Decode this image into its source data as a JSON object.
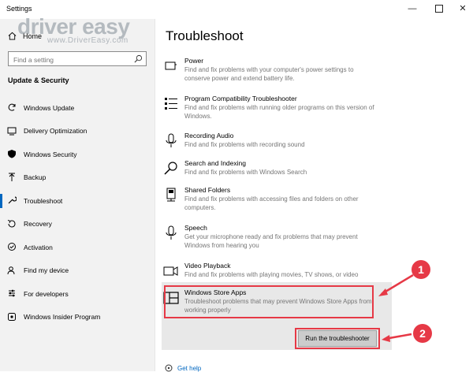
{
  "window": {
    "title": "Settings",
    "controls": {
      "minimize": "—",
      "close": "✕"
    }
  },
  "watermark": {
    "brand": "driver easy",
    "url": "www.DriverEasy.com"
  },
  "sidebar": {
    "home_label": "Home",
    "search_placeholder": "Find a setting",
    "section_title": "Update & Security",
    "items": [
      {
        "label": "Windows Update",
        "icon": "sync-icon"
      },
      {
        "label": "Delivery Optimization",
        "icon": "delivery-optimization-icon"
      },
      {
        "label": "Windows Security",
        "icon": "shield-icon"
      },
      {
        "label": "Backup",
        "icon": "upload-arrow-icon"
      },
      {
        "label": "Troubleshoot",
        "icon": "wrench-icon",
        "active": true
      },
      {
        "label": "Recovery",
        "icon": "recovery-icon"
      },
      {
        "label": "Activation",
        "icon": "check-circle-icon"
      },
      {
        "label": "Find my device",
        "icon": "person-location-icon"
      },
      {
        "label": "For developers",
        "icon": "developer-sliders-icon"
      },
      {
        "label": "Windows Insider Program",
        "icon": "insider-icon"
      }
    ]
  },
  "main": {
    "title": "Troubleshoot",
    "items": [
      {
        "name": "Power",
        "desc": "Find and fix problems with your computer's power settings to conserve power and extend battery life.",
        "icon": "power-icon"
      },
      {
        "name": "Program Compatibility Troubleshooter",
        "desc": "Find and fix problems with running older programs on this version of Windows.",
        "icon": "list-icon"
      },
      {
        "name": "Recording Audio",
        "desc": "Find and fix problems with recording sound",
        "icon": "microphone-icon"
      },
      {
        "name": "Search and Indexing",
        "desc": "Find and fix problems with Windows Search",
        "icon": "search-icon"
      },
      {
        "name": "Shared Folders",
        "desc": "Find and fix problems with accessing files and folders on other computers.",
        "icon": "shared-folders-icon"
      },
      {
        "name": "Speech",
        "desc": "Get your microphone ready and fix problems that may prevent Windows from hearing you",
        "icon": "microphone-icon"
      },
      {
        "name": "Video Playback",
        "desc": "Find and fix problems with playing movies, TV shows, or video",
        "icon": "video-icon"
      },
      {
        "name": "Windows Store Apps",
        "desc": "Troubleshoot problems that may prevent Windows Store Apps from working properly",
        "icon": "store-apps-icon"
      }
    ],
    "run_button_label": "Run the troubleshooter",
    "get_help_label": "Get help"
  },
  "annotations": {
    "callout1": "1",
    "callout2": "2",
    "accent_color": "#e63946"
  }
}
